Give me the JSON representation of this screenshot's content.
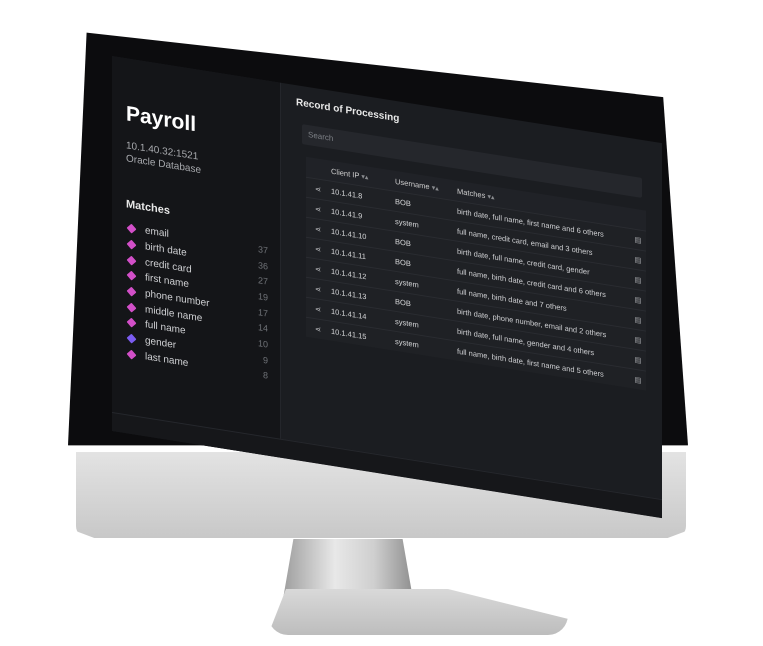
{
  "app": {
    "title": "Payroll",
    "host": "10.1.40.32:1521",
    "db_type": "Oracle Database"
  },
  "sidebar": {
    "matches_heading": "Matches",
    "items": [
      {
        "label": "email",
        "count": "37"
      },
      {
        "label": "birth date",
        "count": "36"
      },
      {
        "label": "credit card",
        "count": "27"
      },
      {
        "label": "first name",
        "count": "19"
      },
      {
        "label": "phone number",
        "count": "17"
      },
      {
        "label": "middle name",
        "count": "14"
      },
      {
        "label": "full name",
        "count": "10"
      },
      {
        "label": "gender",
        "count": "9"
      },
      {
        "label": "last name",
        "count": "8"
      }
    ]
  },
  "main": {
    "section_title": "Record of Processing",
    "search_placeholder": "Search",
    "columns": {
      "ip": "Client IP",
      "user": "Username",
      "matches": "Matches",
      "sort": "▾▴"
    },
    "rows": [
      {
        "ip": "10.1.41.8",
        "user": "BOB",
        "matches": "birth date, full name, first name and 6 others"
      },
      {
        "ip": "10.1.41.9",
        "user": "system",
        "matches": "full name, credit card, email and 3 others"
      },
      {
        "ip": "10.1.41.10",
        "user": "BOB",
        "matches": "birth date, full name, credit card, gender"
      },
      {
        "ip": "10.1.41.11",
        "user": "BOB",
        "matches": "full name, birth date, credit card and 6 others"
      },
      {
        "ip": "10.1.41.12",
        "user": "system",
        "matches": "full name, birth date and 7 others"
      },
      {
        "ip": "10.1.41.13",
        "user": "BOB",
        "matches": "birth date, phone number, email and 2 others"
      },
      {
        "ip": "10.1.41.14",
        "user": "system",
        "matches": "birth date, full name, gender and 4 others"
      },
      {
        "ip": "10.1.41.15",
        "user": "system",
        "matches": "full name, birth date, first name and 5 others"
      }
    ]
  },
  "icons": {
    "share": "share-icon",
    "doc": "document-icon",
    "tag": "tag-icon"
  },
  "colors": {
    "tag_pink": "#d24fc8",
    "tag_purple": "#7b5cf0",
    "screen_bg": "#1b1d21"
  }
}
